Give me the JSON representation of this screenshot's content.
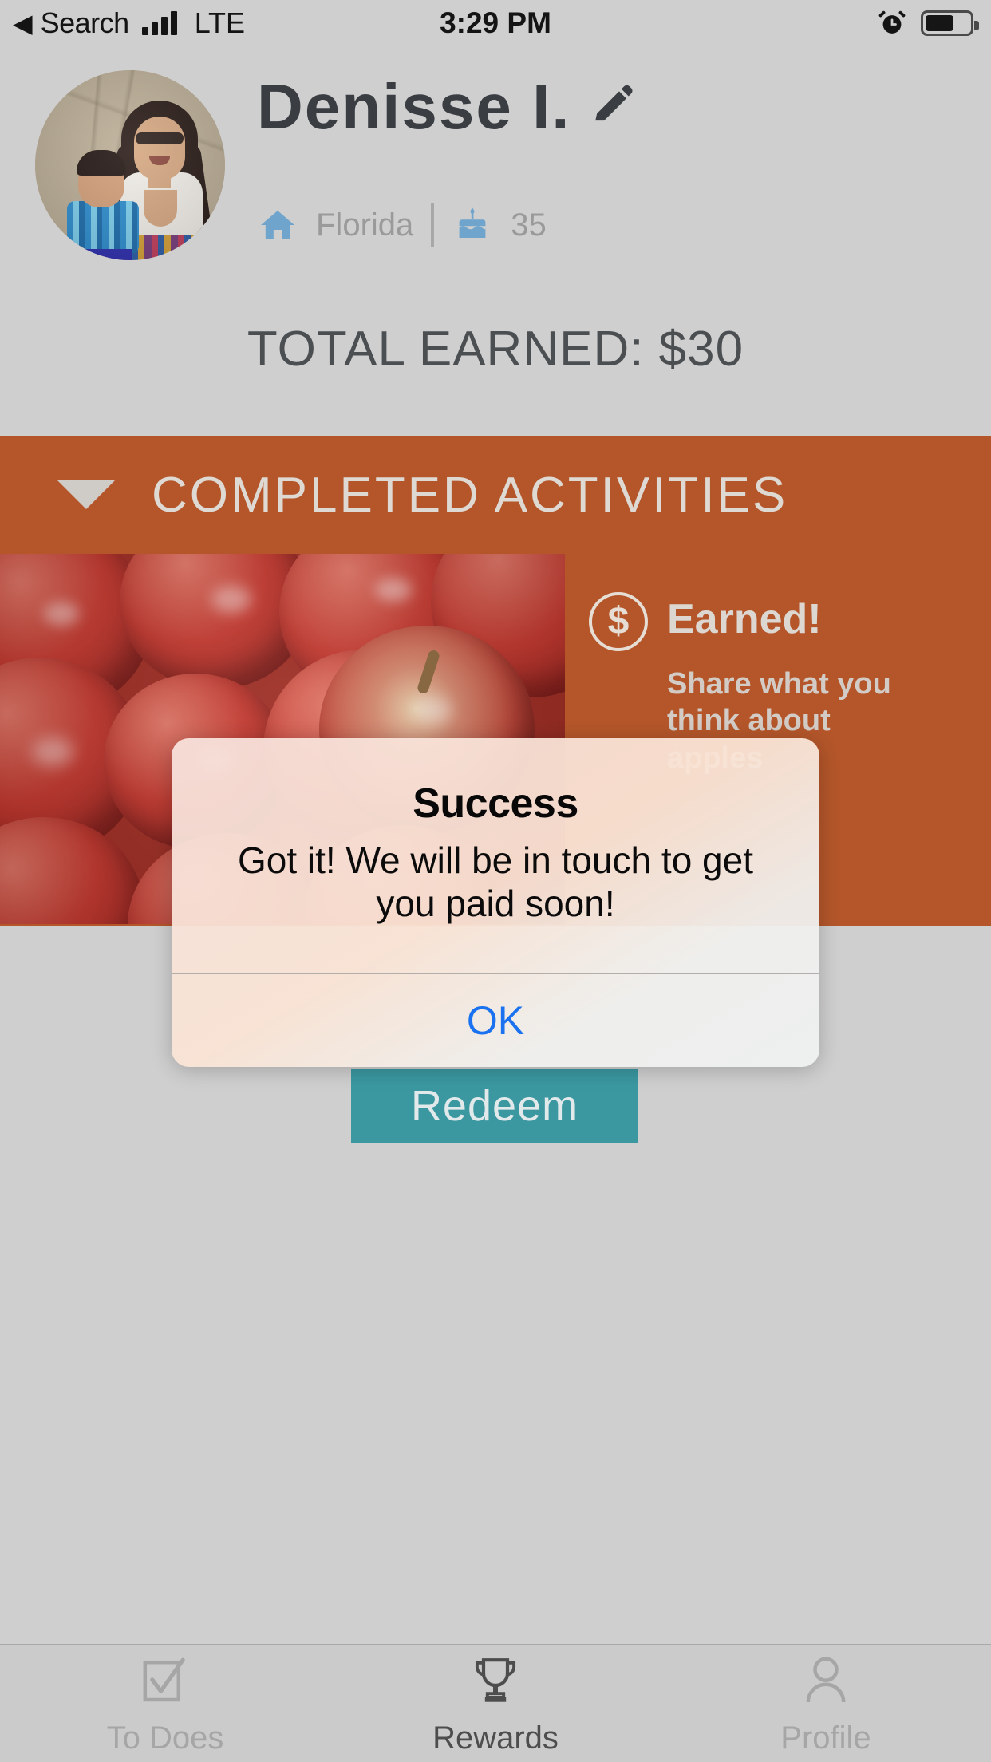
{
  "statusbar": {
    "back_label": "Search",
    "back_icon": "triangle-left-icon",
    "signal_icon": "cellular-signal-icon",
    "network": "LTE",
    "time": "3:29 PM",
    "alarm_icon": "alarm-clock-icon",
    "battery_icon": "battery-icon"
  },
  "profile": {
    "avatar_alt": "profile-photo-woman-and-child",
    "name": "Denisse I.",
    "edit_icon": "pencil-icon",
    "location_icon": "home-icon",
    "location": "Florida",
    "age_icon": "birthday-cake-icon",
    "age": "35"
  },
  "summary": {
    "total_earned": "TOTAL EARNED: $30"
  },
  "section": {
    "caret_icon": "caret-down-icon",
    "title": "COMPLETED ACTIVITIES"
  },
  "activity": {
    "image_alt": "red-apples-photo",
    "badge_icon": "dollar-circle-icon",
    "status": "Earned!",
    "description": "Share what you think about apples"
  },
  "actions": {
    "redeem_label": "Redeem"
  },
  "alert": {
    "title": "Success",
    "message": "Got it! We will be in touch to get you paid soon!",
    "ok_label": "OK"
  },
  "tabbar": {
    "tabs": [
      {
        "label": "To Does",
        "icon": "checkbox-check-icon",
        "active": false
      },
      {
        "label": "Rewards",
        "icon": "trophy-icon",
        "active": true
      },
      {
        "label": "Profile",
        "icon": "person-icon",
        "active": false
      }
    ]
  },
  "colors": {
    "background": "#cfcfcf",
    "accent_orange": "#b4562a",
    "redeem_teal": "#3b98a1",
    "link_blue": "#1a72f0",
    "icon_blue": "#6fa4cc"
  }
}
